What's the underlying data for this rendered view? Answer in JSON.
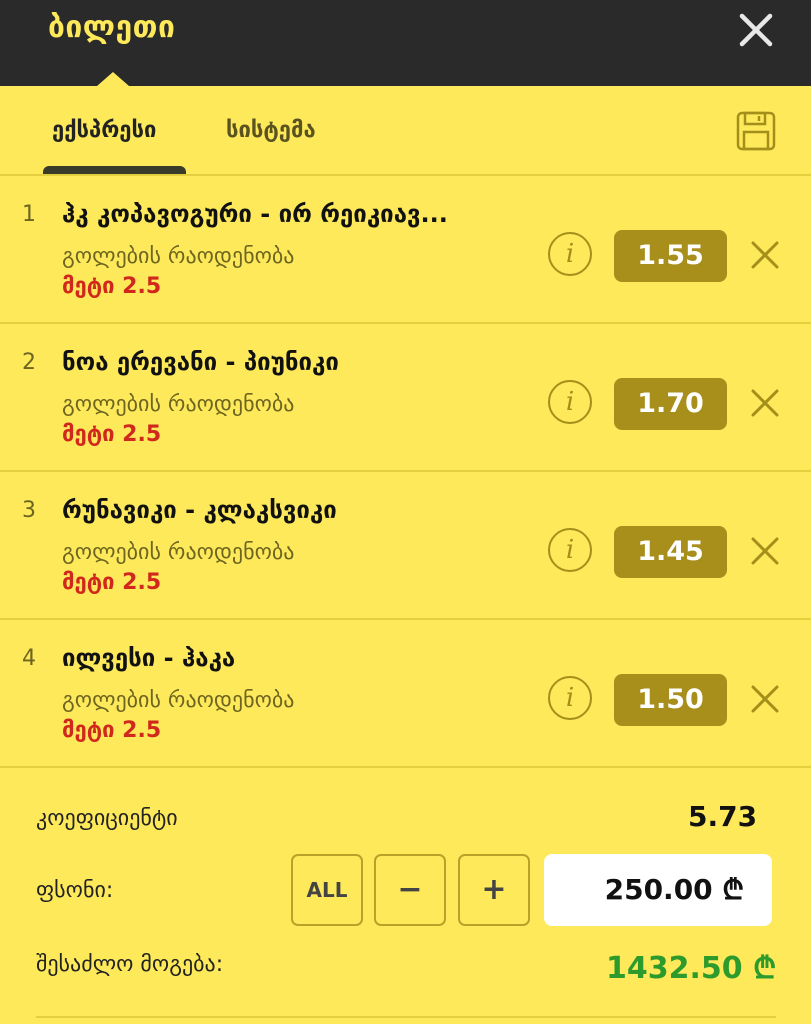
{
  "header": {
    "title": "ბილეთი"
  },
  "tabs": [
    {
      "label": "ექსპრესი",
      "active": true
    },
    {
      "label": "სისტემა",
      "active": false
    }
  ],
  "bets": [
    {
      "number": "1",
      "match": "ჰკ კოპავოგური - ირ რეიკიავ...",
      "market": "გოლების რაოდენობა",
      "pick": "მეტი 2.5",
      "odds": "1.55"
    },
    {
      "number": "2",
      "match": "ნოა ერევანი - პიუნიკი",
      "market": "გოლების რაოდენობა",
      "pick": "მეტი 2.5",
      "odds": "1.70"
    },
    {
      "number": "3",
      "match": "რუნავიკი - კლაკსვიკი",
      "market": "გოლების რაოდენობა",
      "pick": "მეტი 2.5",
      "odds": "1.45"
    },
    {
      "number": "4",
      "match": "ილვესი - ჰაკა",
      "market": "გოლების რაოდენობა",
      "pick": "მეტი 2.5",
      "odds": "1.50"
    }
  ],
  "info_symbol": "i",
  "summary": {
    "coef_label": "კოეფიციენტი",
    "coef_value": "5.73",
    "stake_label": "ფსონი:",
    "all_label": "ALL",
    "minus_label": "−",
    "plus_label": "+",
    "stake_value": "250.00 ₾",
    "win_label": "შესაძლო მოგება:",
    "win_value": "1432.50 ₾"
  },
  "colors": {
    "bg": "#fde95a",
    "topbar": "#2a2a2a",
    "odds": "#a88f1c",
    "pick": "#d0281d",
    "win": "#2c9b2c"
  }
}
